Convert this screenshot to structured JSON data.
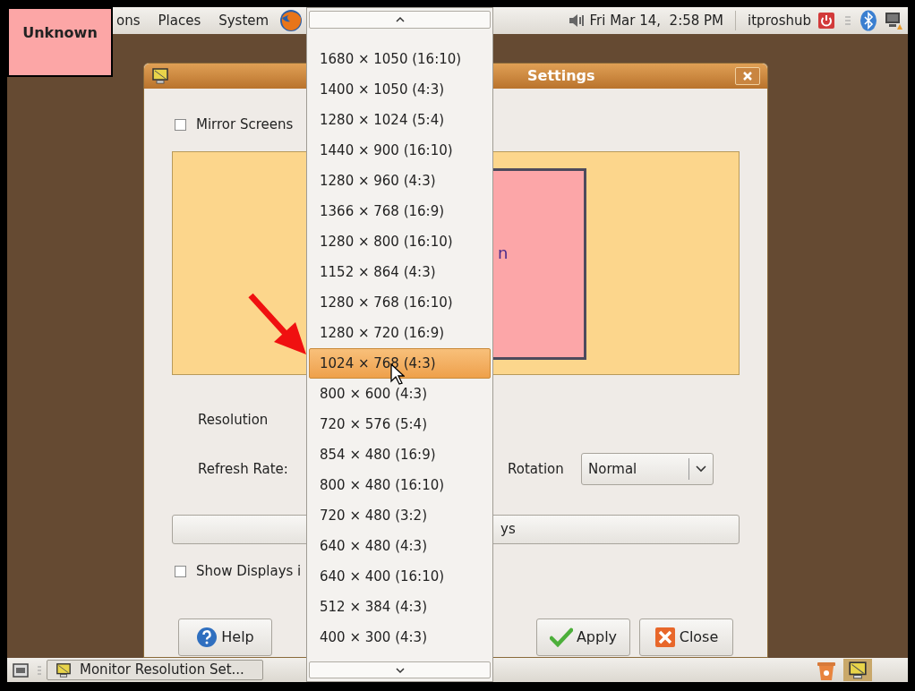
{
  "top_panel": {
    "menus": [
      {
        "label": "ons"
      },
      {
        "label": "Places"
      },
      {
        "label": "System"
      }
    ],
    "clock": "Fri Mar 14,  2:58 PM",
    "user": "itproshub"
  },
  "overlay_label": "Unknown",
  "dialog": {
    "title": "Settings",
    "mirror_screens": {
      "label": "Mirror Screens",
      "checked": false
    },
    "preview": {
      "monitor_label": "n"
    },
    "resolution": {
      "label": "Resolution"
    },
    "refresh_rate": {
      "label": "Refresh Rate:"
    },
    "rotation": {
      "label": "Rotation",
      "value": "Normal"
    },
    "detect_button": "ys",
    "show_displays": {
      "label": "Show Displays i",
      "checked": false
    },
    "buttons": [
      {
        "kind": "help",
        "label": "Help"
      },
      {
        "kind": "apply",
        "label": "Apply"
      },
      {
        "kind": "close",
        "label": "Close"
      }
    ]
  },
  "dropdown": {
    "items": [
      {
        "label": "1680 × 1050 (16:10)",
        "selected": false
      },
      {
        "label": "1400 × 1050 (4:3)",
        "selected": false
      },
      {
        "label": "1280 × 1024 (5:4)",
        "selected": false
      },
      {
        "label": "1440 × 900 (16:10)",
        "selected": false
      },
      {
        "label": "1280 × 960 (4:3)",
        "selected": false
      },
      {
        "label": "1366 × 768 (16:9)",
        "selected": false
      },
      {
        "label": "1280 × 800 (16:10)",
        "selected": false
      },
      {
        "label": "1152 × 864 (4:3)",
        "selected": false
      },
      {
        "label": "1280 × 768 (16:10)",
        "selected": false
      },
      {
        "label": "1280 × 720 (16:9)",
        "selected": false
      },
      {
        "label": "1024 × 768 (4:3)",
        "selected": true
      },
      {
        "label": "800 × 600 (4:3)",
        "selected": false
      },
      {
        "label": "720 × 576 (5:4)",
        "selected": false
      },
      {
        "label": "854 × 480 (16:9)",
        "selected": false
      },
      {
        "label": "800 × 480 (16:10)",
        "selected": false
      },
      {
        "label": "720 × 480 (3:2)",
        "selected": false
      },
      {
        "label": "640 × 480 (4:3)",
        "selected": false
      },
      {
        "label": "640 × 400 (16:10)",
        "selected": false
      },
      {
        "label": "512 × 384 (4:3)",
        "selected": false
      },
      {
        "label": "400 × 300 (4:3)",
        "selected": false
      }
    ]
  },
  "taskbar": {
    "tasks": [
      {
        "label": "Monitor Resolution Set..."
      }
    ]
  }
}
